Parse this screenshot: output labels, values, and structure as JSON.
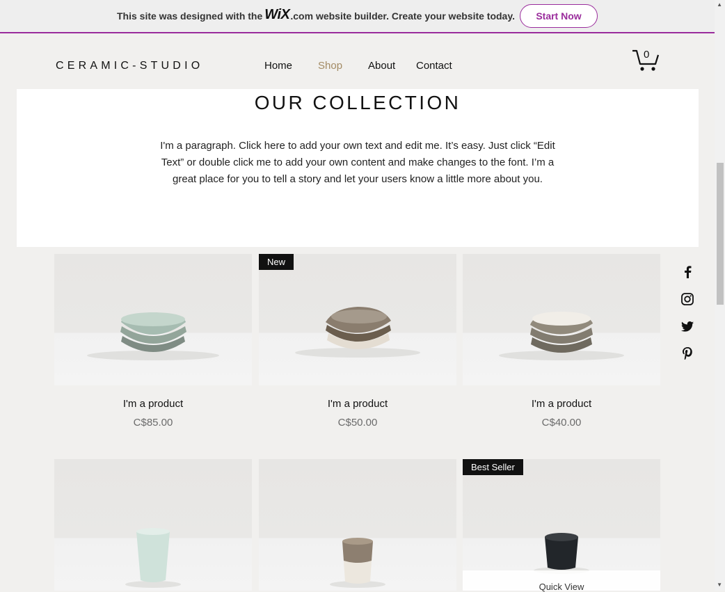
{
  "wix_banner": {
    "prefix": "This site was designed with the",
    "brand": "WiX",
    "suffix": ".com website builder. Create your website today.",
    "cta": "Start Now"
  },
  "header": {
    "logo": "CERAMIC-STUDIO",
    "nav": [
      "Home",
      "Shop",
      "About",
      "Contact"
    ],
    "active_nav": "Shop",
    "cart_count": "0"
  },
  "collection": {
    "title": "OUR COLLECTION",
    "paragraph": "I'm a paragraph. Click here to add your own text and edit me. It’s easy. Just click “Edit Text” or double click me to add your own content and make changes to the font. I’m a great place for you to tell a story and let your users know a little more about you."
  },
  "social": [
    "facebook-icon",
    "instagram-icon",
    "twitter-icon",
    "pinterest-icon"
  ],
  "products": [
    {
      "name": "I'm a product",
      "price": "C$85.00",
      "badge": ""
    },
    {
      "name": "I'm a product",
      "price": "C$50.00",
      "badge": "New"
    },
    {
      "name": "I'm a product",
      "price": "C$40.00",
      "badge": ""
    },
    {
      "name": "",
      "price": "",
      "badge": ""
    },
    {
      "name": "",
      "price": "",
      "badge": ""
    },
    {
      "name": "",
      "price": "",
      "badge": "Best Seller",
      "quick_view": "Quick View"
    }
  ],
  "colors": {
    "accent": "#9a2c9c",
    "active_nav": "#a38b64",
    "price": "#6b6b6b"
  }
}
